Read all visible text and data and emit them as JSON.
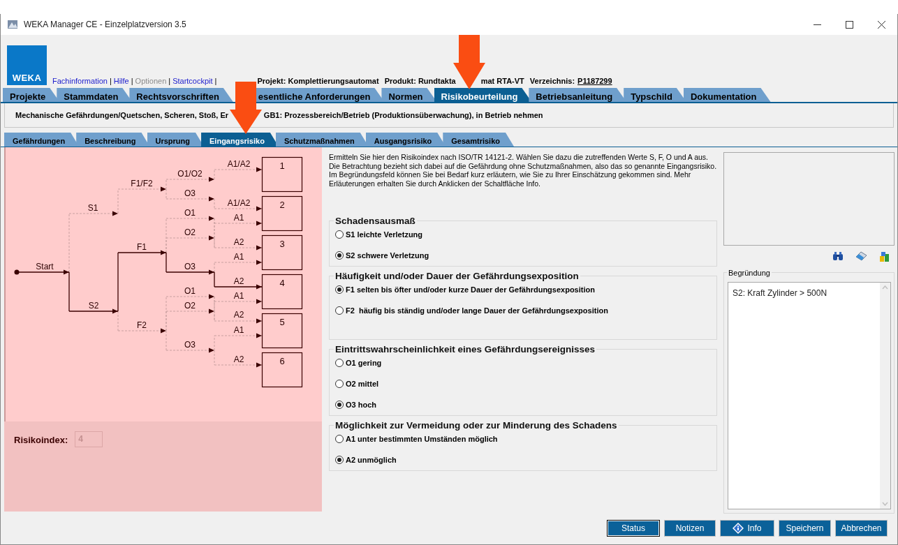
{
  "window": {
    "title": "WEKA Manager CE - Einzelplatzversion 3.5"
  },
  "logo": {
    "text": "WEKA"
  },
  "links": [
    {
      "text": "Fachinformation",
      "disabled": false,
      "separator": "|"
    },
    {
      "text": "Hilfe",
      "disabled": false,
      "separator": "|"
    },
    {
      "text": "Optionen",
      "disabled": true,
      "separator": "|"
    },
    {
      "text": "Startcockpit",
      "disabled": false,
      "separator": "|"
    }
  ],
  "project_info": {
    "project": "Projekt: Komplettierungsautomat",
    "product_start": "Produkt: Rundtakta",
    "product_end": "mat RTA-VT",
    "directory_label": "Verzeichnis:",
    "directory_value": "P1187299"
  },
  "main_tabs": [
    {
      "label": "Projekte",
      "selected": false
    },
    {
      "label": "Stammdaten",
      "selected": false
    },
    {
      "label": "Rechtsvorschriften",
      "selected": false
    },
    {
      "label": "esentliche Anforderungen",
      "selected": false
    },
    {
      "label": "Normen",
      "selected": false
    },
    {
      "label": "Risikobeurteilung",
      "selected": true
    },
    {
      "label": "Betriebsanleitung",
      "selected": false
    },
    {
      "label": "Typschild",
      "selected": false
    },
    {
      "label": "Dokumentation",
      "selected": false
    }
  ],
  "subtitle": [
    "Mechanische Gefährdungen/Quetschen, Scheren, Stoß, Er",
    "GB1: Prozessbereich/Betrieb (Produktionsüberwachung), in Betrieb nehmen"
  ],
  "sub_tabs": [
    {
      "label": "Gefährdungen",
      "selected": false
    },
    {
      "label": "Beschreibung",
      "selected": false
    },
    {
      "label": "Ursprung",
      "selected": false
    },
    {
      "label": "Eingangsrisiko",
      "selected": true
    },
    {
      "label": "Schutzmaßnahmen",
      "selected": false
    },
    {
      "label": "Ausgangsrisiko",
      "selected": false
    },
    {
      "label": "Gesamtrisiko",
      "selected": false
    }
  ],
  "diagram": {
    "labels": [
      "Start",
      "S1",
      "S2",
      "F1/F2",
      "F1",
      "F2",
      "O1/O2",
      "O3",
      "O1",
      "O2",
      "O3",
      "O1",
      "O2",
      "O3",
      "A1/A2",
      "A1/A2",
      "A1",
      "A2",
      "A1",
      "A2",
      "A1",
      "A2",
      "A1",
      "A2"
    ],
    "boxes": [
      "1",
      "2",
      "3",
      "4",
      "5",
      "6"
    ]
  },
  "risk_index": {
    "label": "Risikoindex:",
    "value": "4",
    "disabled": true
  },
  "description": "Ermitteln Sie hier den Risikoindex nach ISO/TR 14121-2. Wählen Sie dazu die zutreffenden Werte S, F, O und A aus. Die Betrachtung bezieht sich dabei auf die Gefährdung ohne Schutzmaßnahmen, also das so genannte Eingangsrisiko. Im Begründungsfeld können Sie bei Bedarf kurz erläutern, wie Sie zu Ihrer Einschätzung gekommen sind. Mehr Erläuterungen erhalten Sie durch Anklicken der Schaltfläche Info.",
  "groups": [
    {
      "title": "Schadensausmaß",
      "options": [
        {
          "label": "S1 leichte Verletzung",
          "selected": false
        },
        {
          "label": "S2 schwere Verletzung",
          "selected": true
        }
      ]
    },
    {
      "title": "Häufigkeit und/oder Dauer der Gefährdungsexposition",
      "options": [
        {
          "label": "F1 selten bis öfter und/oder kurze Dauer der Gefährdungsexposition",
          "selected": true
        },
        {
          "label": "F2  häufig bis ständig und/oder lange Dauer der Gefährdungsexposition",
          "selected": false
        }
      ]
    },
    {
      "title": "Eintrittswahrscheinlichkeit eines Gefährdungsereignisses",
      "options": [
        {
          "label": "O1 gering",
          "selected": false
        },
        {
          "label": "O2 mittel",
          "selected": false
        },
        {
          "label": "O3 hoch",
          "selected": true
        }
      ]
    },
    {
      "title": "Möglichkeit zur Vermeidung oder zur Minderung des Schadens",
      "options": [
        {
          "label": "A1 unter bestimmten Umständen möglich",
          "selected": false
        },
        {
          "label": "A2 unmöglich",
          "selected": true
        }
      ]
    }
  ],
  "reason": {
    "label": "Begründung",
    "value": "S2: Kraft Zylinder > 500N"
  },
  "buttons": [
    {
      "label": "Status",
      "default": true,
      "kind": "plain"
    },
    {
      "label": "Notizen",
      "default": false,
      "kind": "plain"
    },
    {
      "label": "Info",
      "default": false,
      "kind": "info"
    },
    {
      "label": "Speichern",
      "default": false,
      "kind": "plain"
    },
    {
      "label": "Abbrechen",
      "default": false,
      "kind": "plain"
    }
  ]
}
